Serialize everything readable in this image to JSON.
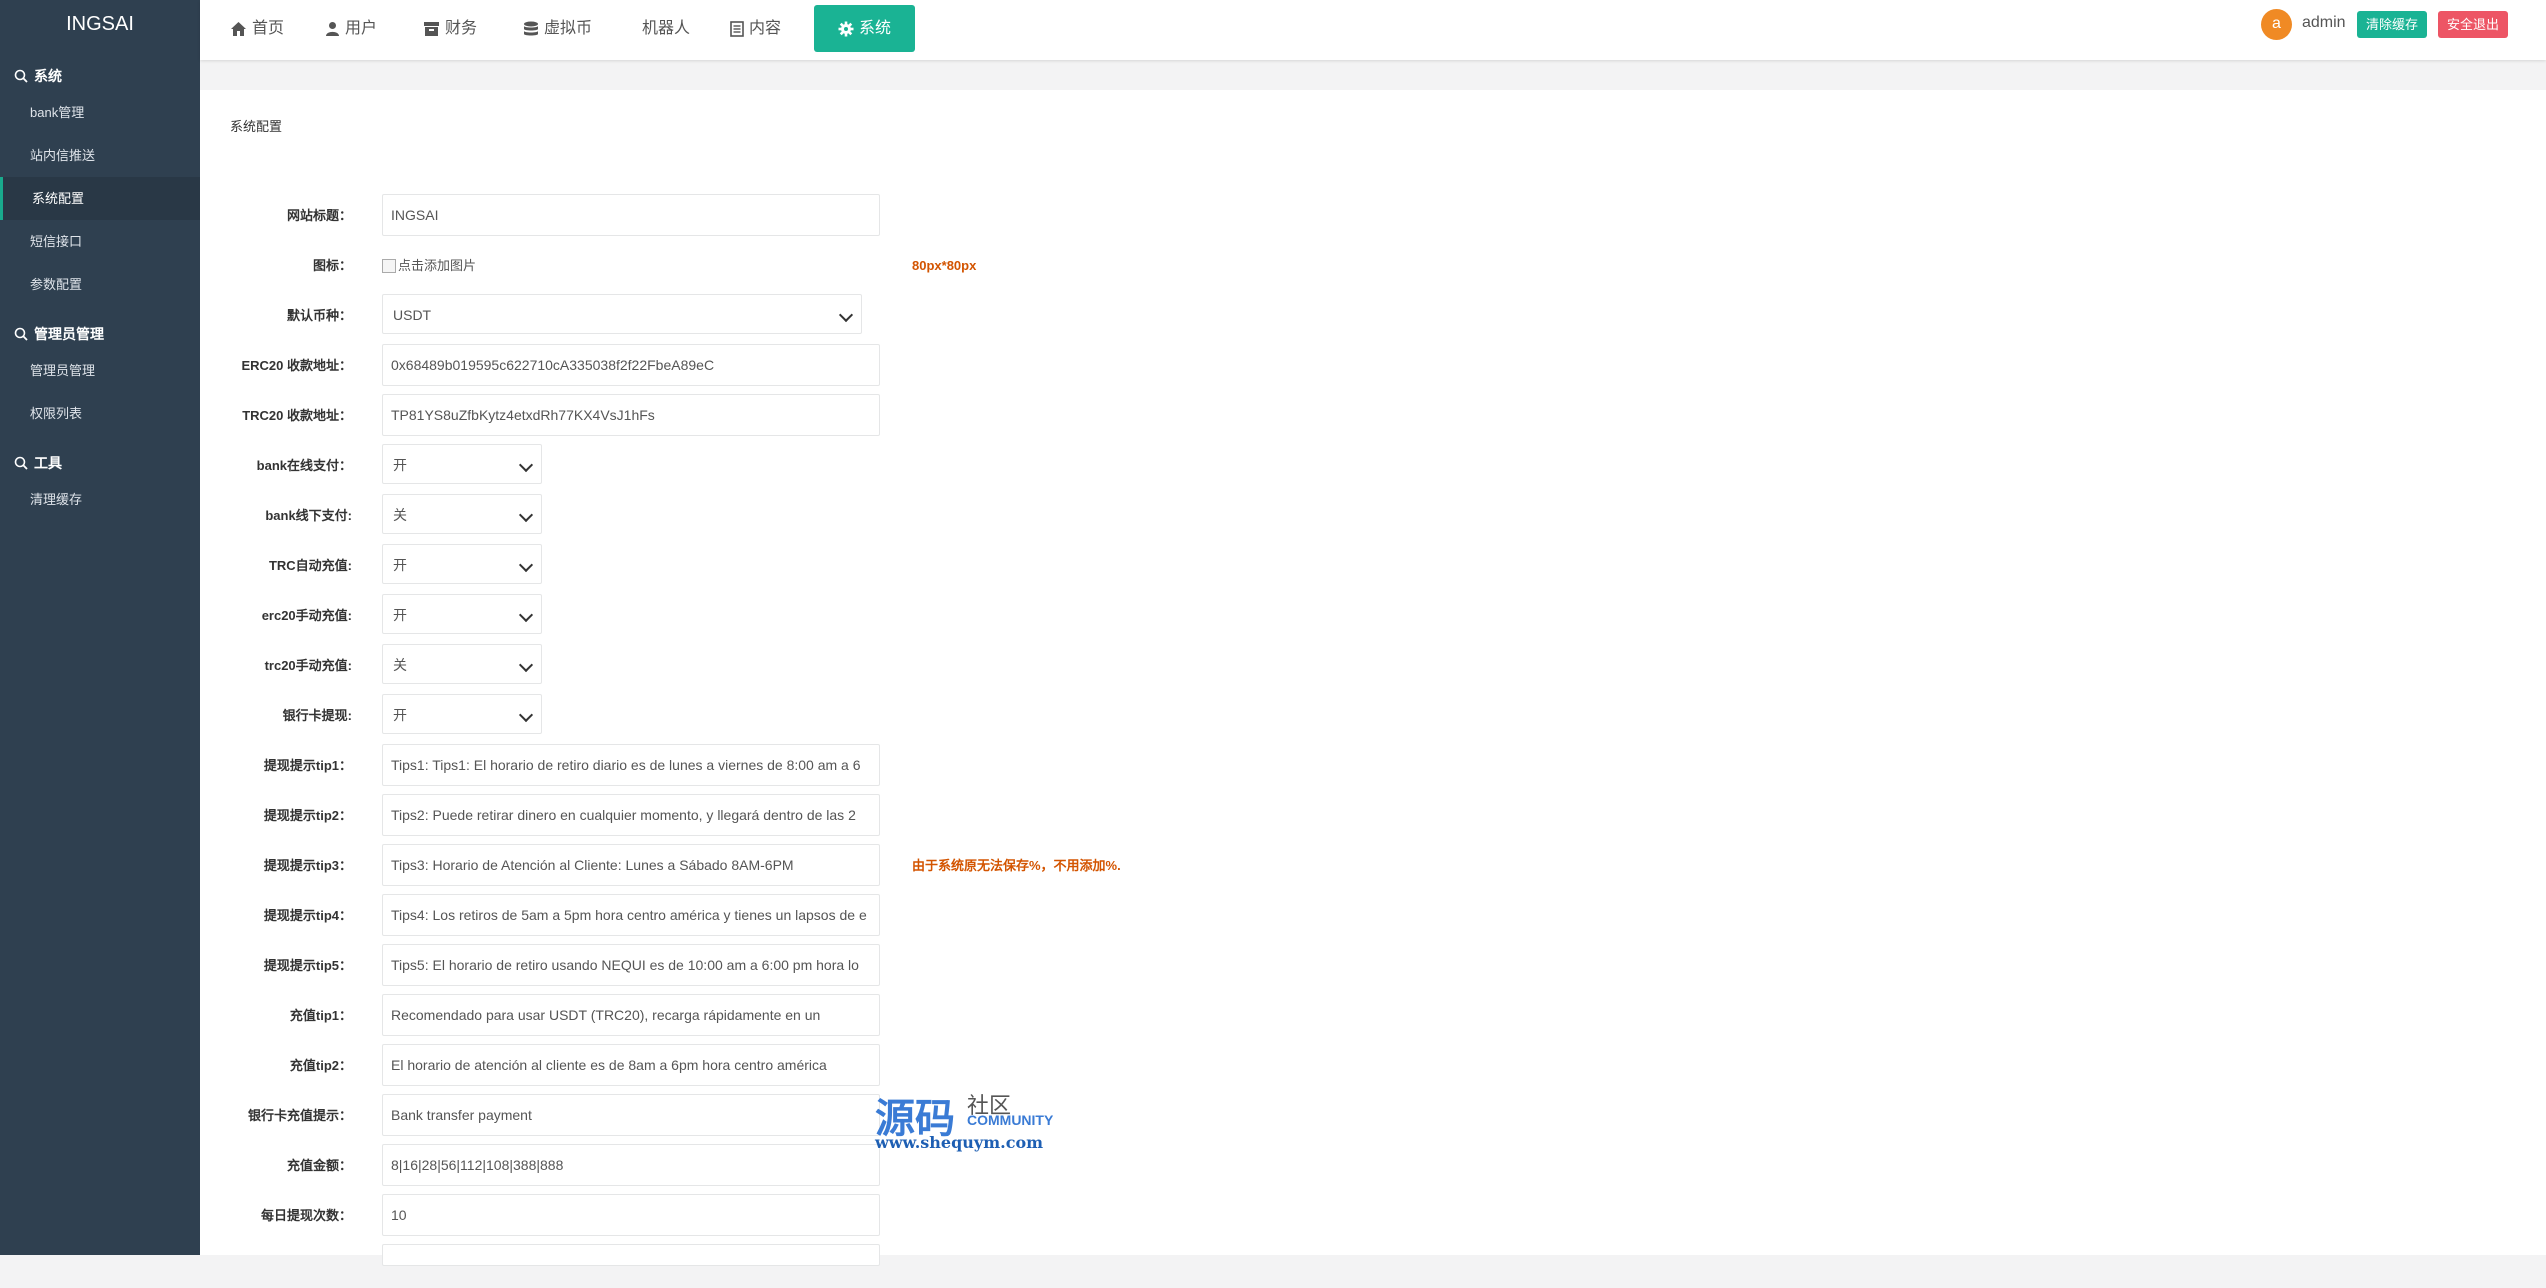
{
  "app": {
    "logo": "INGSAI"
  },
  "sidebar": {
    "groups": [
      {
        "label": "系统",
        "items": [
          "bank管理",
          "站内信推送",
          "系统配置",
          "短信接口",
          "参数配置"
        ]
      },
      {
        "label": "管理员管理",
        "items": [
          "管理员管理",
          "权限列表"
        ]
      },
      {
        "label": "工具",
        "items": [
          "清理缓存"
        ]
      }
    ],
    "active_item": "系统配置"
  },
  "topnav": {
    "tabs": [
      "首页",
      "用户",
      "财务",
      "虚拟币",
      "机器人",
      "内容",
      "系统"
    ],
    "active_tab": "系统"
  },
  "user": {
    "avatar_letter": "a",
    "name": "admin",
    "clear_cache_label": "清除缓存",
    "logout_label": "安全退出"
  },
  "colors": {
    "accent": "#1ab394",
    "danger": "#ed5565",
    "sidebar": "#2f4050",
    "hint": "#d35400"
  },
  "page": {
    "section_title": "系统配置"
  },
  "form": {
    "site_title": {
      "label": "网站标题：",
      "value": "INGSAI"
    },
    "icon": {
      "label": "图标：",
      "alt": "点击添加图片",
      "hint": "80px*80px"
    },
    "default_currency": {
      "label": "默认币种：",
      "value": "USDT"
    },
    "erc20_address": {
      "label": "ERC20 收款地址：",
      "value": "0x68489b019595c622710cA335038f2f22FbeA89eC"
    },
    "trc20_address": {
      "label": "TRC20 收款地址：",
      "value": "TP81YS8uZfbKytz4etxdRh77KX4VsJ1hFs"
    },
    "bank_online": {
      "label": "bank在线支付：",
      "value": "开"
    },
    "bank_offline": {
      "label": "bank线下支付:",
      "value": "关"
    },
    "trc_auto": {
      "label": "TRC自动充值:",
      "value": "开"
    },
    "erc20_manual": {
      "label": "erc20手动充值:",
      "value": "开"
    },
    "trc20_manual": {
      "label": "trc20手动充值:",
      "value": "关"
    },
    "bank_withdraw": {
      "label": "银行卡提现:",
      "value": "开"
    },
    "tip1": {
      "label": "提现提示tip1：",
      "value": "Tips1: Tips1: El horario de retiro diario es de lunes a viernes de 8:00 am a 6"
    },
    "tip2": {
      "label": "提现提示tip2：",
      "value": "Tips2: Puede retirar dinero en cualquier momento, y llegará dentro de las 2"
    },
    "tip3": {
      "label": "提现提示tip3：",
      "value": "Tips3: Horario de Atención al Cliente: Lunes a Sábado 8AM-6PM",
      "hint": "由于系统原无法保存%，不用添加%."
    },
    "tip4": {
      "label": "提现提示tip4：",
      "value": "Tips4: Los retiros de 5am a 5pm hora centro américa y tienes un lapsos de e"
    },
    "tip5": {
      "label": "提现提示tip5：",
      "value": "Tips5: El horario de retiro usando NEQUI es de 10:00 am a 6:00 pm hora lo"
    },
    "recharge_tip1": {
      "label": "充值tip1：",
      "value": "Recomendado para usar USDT (TRC20), recarga rápidamente en un"
    },
    "recharge_tip2": {
      "label": "充值tip2：",
      "value": "El horario de atención al cliente es de 8am a 6pm  hora centro américa"
    },
    "bank_recharge_tip": {
      "label": "银行卡充值提示：",
      "value": "Bank transfer payment"
    },
    "recharge_amount": {
      "label": "充值金额：",
      "value": "8|16|28|56|112|108|388|888"
    },
    "daily_withdraw_count": {
      "label": "每日提现次数：",
      "value": "10"
    }
  },
  "watermark": {
    "big": "源码",
    "small": "社区",
    "community": "COMMUNITY",
    "url": "www.shequym.com"
  }
}
